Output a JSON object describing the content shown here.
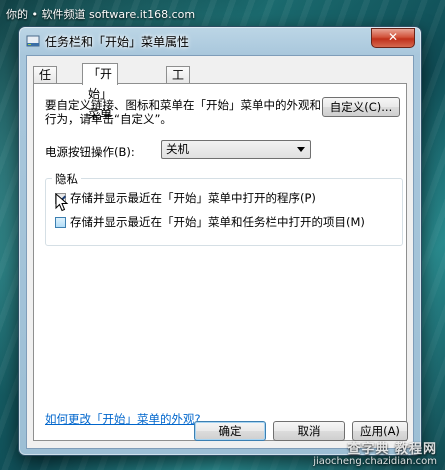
{
  "watermark": {
    "top": "你的 • 软件频道 software.it168.com",
    "bottom_line1": "查字典 教程网",
    "bottom_line2": "jiaocheng.chazidian.com"
  },
  "window": {
    "title": "任务栏和「开始」菜单属性",
    "close_label": "✕"
  },
  "tabs": [
    {
      "label": "任务栏",
      "active": false
    },
    {
      "label": "「开始」菜单",
      "active": true
    },
    {
      "label": "工具栏",
      "active": false
    }
  ],
  "panel": {
    "description": "要自定义链接、图标和菜单在「开始」菜单中的外观和行为，请单击“自定义”。",
    "customize_button": "自定义(C)...",
    "power_label": "电源按钮操作(B):",
    "power_selected": "关机",
    "privacy_group": "隐私",
    "check1_label": "存储并显示最近在「开始」菜单中打开的程序(P)",
    "check1_checked": true,
    "check2_label": "存储并显示最近在「开始」菜单和任务栏中打开的项目(M)",
    "check2_checked": false,
    "link": "如何更改「开始」菜单的外观?"
  },
  "footer": {
    "ok": "确定",
    "cancel": "取消",
    "apply": "应用(A)"
  },
  "colors": {
    "link": "#0066cc",
    "close": "#c0311b",
    "desktop": "#1b6a6e"
  }
}
